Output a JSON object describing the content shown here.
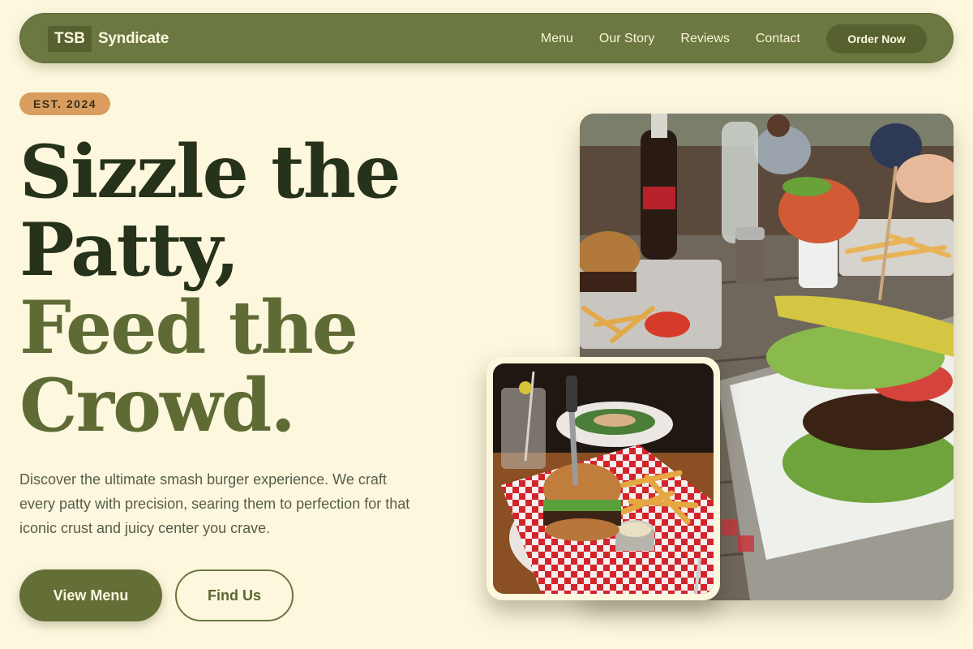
{
  "nav": {
    "logo_mark": "TSB",
    "logo_text": "Syndicate",
    "links": [
      "Menu",
      "Our Story",
      "Reviews",
      "Contact"
    ],
    "cta": "Order Now"
  },
  "hero": {
    "badge": "EST. 2024",
    "headline": [
      "Sizzle the",
      "Patty,",
      "Feed the",
      "Crowd."
    ],
    "description": "Discover the ultimate smash burger experience. We craft every patty with precision, searing them to perfection for that iconic crust and juicy center you crave.",
    "primary_button": "View Menu",
    "secondary_button": "Find Us"
  },
  "images": {
    "main_label": "Outdoor table with burgers, fries, soda bottle and pickle spear",
    "secondary_label": "Burger with fries on red checkered paper"
  },
  "colors": {
    "background": "#fdf7de",
    "olive": "#6b7841",
    "olive_dark": "#56612f",
    "headline_dark": "#263219",
    "headline_olive": "#5f6b35",
    "badge": "#d99e5f"
  }
}
